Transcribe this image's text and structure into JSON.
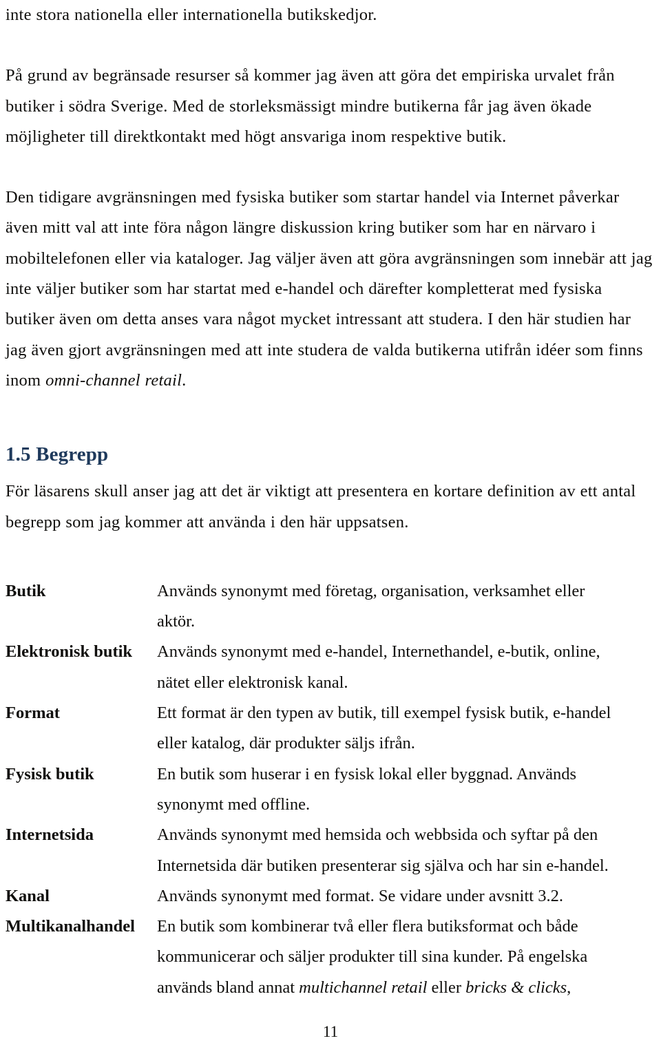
{
  "document": {
    "language": "sv",
    "page_number": "11",
    "heading_color": "#1f3a5c",
    "text_color": "#100f0d",
    "background_color": "#ffffff"
  },
  "paragraphs": {
    "p1_continued": "inte stora nationella eller internationella butikskedjor.",
    "p2_line1": "På grund av begränsade resurser så kommer jag även att göra det empiriska urvalet från",
    "p2_line2": "butiker i södra Sverige. Med de storleksmässigt mindre butikerna får jag även ökade",
    "p2_line3": "möjligheter till direktkontakt med högt ansvariga inom respektive butik.",
    "p3_line1": "Den tidigare avgränsningen med fysiska butiker som startar handel via Internet",
    "p3_line2": "påverkar även mitt val att inte föra någon längre diskussion kring butiker som har en",
    "p3_line3": "närvaro i mobiltelefonen eller via kataloger. Jag väljer även att göra avgränsningen som",
    "p3_line4": "innebär att jag inte väljer butiker som har startat med e-handel och därefter",
    "p3_line5": "kompletterat med fysiska butiker även om detta anses vara något mycket intressant att",
    "p3_line6": "studera. I den här studien har jag även gjort avgränsningen med att inte studera de valda",
    "p3_line7_pre": "butikerna utifrån idéer som finns inom ",
    "p3_line7_italic": "omni-channel retail",
    "p3_line7_post": "."
  },
  "section": {
    "number": "1.5",
    "title": "Begrepp",
    "heading_full": "1.5 Begrepp",
    "intro_line1": "För läsarens skull anser jag att det är viktigt att presentera en kortare definition av ett",
    "intro_line2": "antal begrepp som jag kommer att använda i den här uppsatsen."
  },
  "glossary": {
    "entries": [
      {
        "term": "Butik",
        "lines": [
          "Används synonymt med företag, organisation, verksamhet eller",
          "aktör."
        ]
      },
      {
        "term": "Elektronisk butik",
        "lines": [
          "Används synonymt med e-handel, Internethandel, e-butik, online,",
          "nätet eller elektronisk kanal."
        ]
      },
      {
        "term": "Format",
        "lines": [
          "Ett format är den typen av butik, till exempel fysisk butik, e-handel",
          "eller katalog, där produkter säljs ifrån."
        ]
      },
      {
        "term": "Fysisk butik",
        "lines": [
          "En butik som huserar i en fysisk lokal eller byggnad. Används",
          "synonymt med offline."
        ]
      },
      {
        "term": "Internetsida",
        "lines": [
          "Används synonymt med hemsida och webbsida och syftar på den",
          "Internetsida där butiken presenterar sig själva och har sin e-handel."
        ]
      },
      {
        "term": "Kanal",
        "lines": [
          "Används synonymt med format. Se vidare under avsnitt 3.2."
        ]
      },
      {
        "term": "Multikanalhandel",
        "lines": [
          "En butik som kombinerar två eller flera butiksformat och både",
          "kommunicerar och säljer produkter till sina kunder. På engelska"
        ],
        "last_line": {
          "pre": "används bland annat ",
          "italic1": "multichannel retail",
          "mid": " eller ",
          "italic2": "bricks & clicks",
          "post": ","
        }
      }
    ]
  }
}
